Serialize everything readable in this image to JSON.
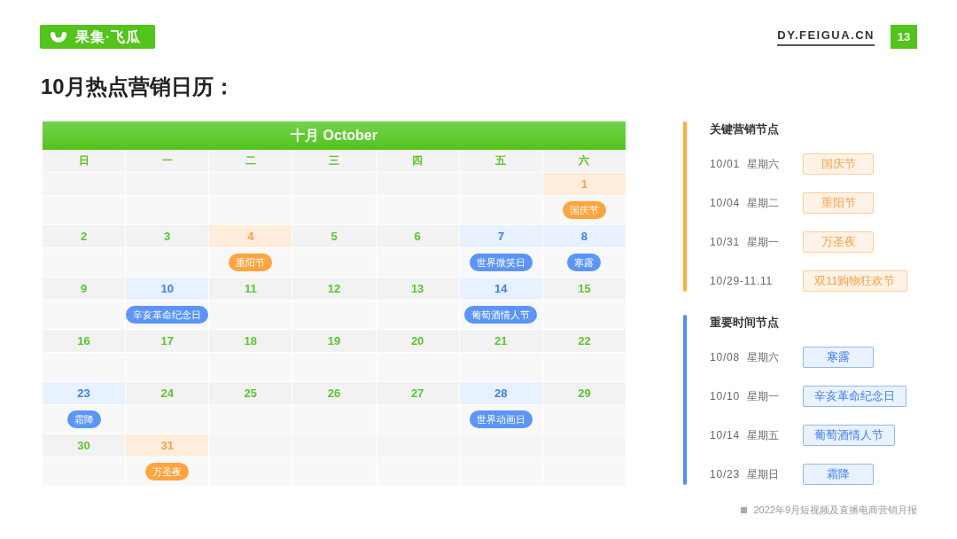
{
  "header": {
    "logo_text": "果集·飞瓜",
    "site": "DY.FEIGUA.CN",
    "page_number": "13"
  },
  "title": "10月热点营销日历：",
  "calendar": {
    "title": "十月 October",
    "weekdays": [
      "日",
      "一",
      "二",
      "三",
      "四",
      "五",
      "六"
    ],
    "weeks": [
      [
        {
          "kind": "blank"
        },
        {
          "kind": "blank"
        },
        {
          "kind": "blank"
        },
        {
          "kind": "blank"
        },
        {
          "kind": "blank"
        },
        {
          "kind": "blank"
        },
        {
          "kind": "marketing",
          "day": "1",
          "event": "国庆节"
        }
      ],
      [
        {
          "kind": "plain",
          "day": "2"
        },
        {
          "kind": "plain",
          "day": "3"
        },
        {
          "kind": "marketing",
          "day": "4",
          "event": "重阳节"
        },
        {
          "kind": "plain",
          "day": "5"
        },
        {
          "kind": "plain",
          "day": "6"
        },
        {
          "kind": "timing",
          "day": "7",
          "event": "世界微笑日"
        },
        {
          "kind": "timing",
          "day": "8",
          "event": "寒露"
        }
      ],
      [
        {
          "kind": "plain",
          "day": "9"
        },
        {
          "kind": "timing",
          "day": "10",
          "event": "辛亥革命纪念日"
        },
        {
          "kind": "plain",
          "day": "11"
        },
        {
          "kind": "plain",
          "day": "12"
        },
        {
          "kind": "plain",
          "day": "13"
        },
        {
          "kind": "timing",
          "day": "14",
          "event": "葡萄酒情人节"
        },
        {
          "kind": "plain",
          "day": "15"
        }
      ],
      [
        {
          "kind": "plain",
          "day": "16"
        },
        {
          "kind": "plain",
          "day": "17"
        },
        {
          "kind": "plain",
          "day": "18"
        },
        {
          "kind": "plain",
          "day": "19"
        },
        {
          "kind": "plain",
          "day": "20"
        },
        {
          "kind": "plain",
          "day": "21"
        },
        {
          "kind": "plain",
          "day": "22"
        }
      ],
      [
        {
          "kind": "timing",
          "day": "23",
          "event": "霜降"
        },
        {
          "kind": "plain",
          "day": "24"
        },
        {
          "kind": "plain",
          "day": "25"
        },
        {
          "kind": "plain",
          "day": "26"
        },
        {
          "kind": "plain",
          "day": "27"
        },
        {
          "kind": "timing",
          "day": "28",
          "event": "世界动画日"
        },
        {
          "kind": "plain",
          "day": "29"
        }
      ],
      [
        {
          "kind": "plain",
          "day": "30"
        },
        {
          "kind": "marketing",
          "day": "31",
          "event": "万圣夜"
        },
        {
          "kind": "blank"
        },
        {
          "kind": "blank"
        },
        {
          "kind": "blank"
        },
        {
          "kind": "blank"
        },
        {
          "kind": "blank"
        }
      ]
    ]
  },
  "legend": [
    {
      "kind": "marketing",
      "title": "关键营销节点",
      "items": [
        {
          "date": "10/01",
          "weekday": "星期六",
          "label": "国庆节"
        },
        {
          "date": "10/04",
          "weekday": "星期二",
          "label": "重阳节"
        },
        {
          "date": "10/31",
          "weekday": "星期一",
          "label": "万圣夜"
        },
        {
          "date": "10/29-11.11",
          "label": "双11购物狂欢节"
        }
      ]
    },
    {
      "kind": "timing",
      "title": "重要时间节点",
      "items": [
        {
          "date": "10/08",
          "weekday": "星期六",
          "label": "寒露"
        },
        {
          "date": "10/10",
          "weekday": "星期一",
          "label": "辛亥革命纪念日"
        },
        {
          "date": "10/14",
          "weekday": "星期五",
          "label": "葡萄酒情人节"
        },
        {
          "date": "10/23",
          "weekday": "星期日",
          "label": "霜降"
        }
      ]
    }
  ],
  "footer": "2022年9月短视频及直播电商营销月报"
}
